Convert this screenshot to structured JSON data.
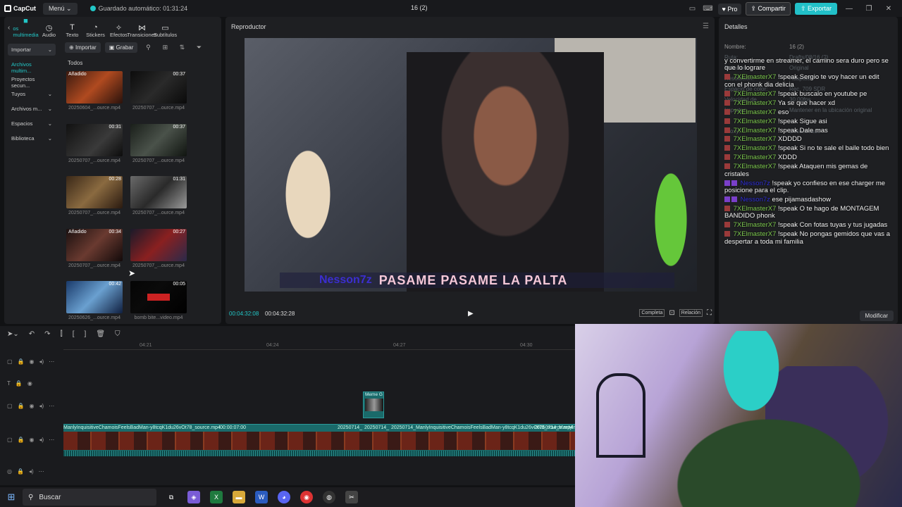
{
  "titlebar": {
    "logo": "CapCut",
    "menu": "Menú",
    "autosave": "Guardado automático: 01:31:24",
    "project_title": "16 (2)",
    "pro": "Pro",
    "share": "Compartir",
    "export": "Exportar"
  },
  "tabs": [
    {
      "icon": "■",
      "label": "os multimedia"
    },
    {
      "icon": "◷",
      "label": "Audio"
    },
    {
      "icon": "T",
      "label": "Texto"
    },
    {
      "icon": "◔",
      "label": "Stickers"
    },
    {
      "icon": "✧",
      "label": "Efectos"
    },
    {
      "icon": "⋈",
      "label": "Transiciones"
    },
    {
      "icon": "▭",
      "label": "Subtítulos"
    }
  ],
  "sidebar": [
    {
      "label": "Importar"
    },
    {
      "label": "Archivos multim..."
    },
    {
      "label": "Proyectos secun..."
    },
    {
      "label": "Tuyos"
    },
    {
      "label": "Archivos m..."
    },
    {
      "label": "Espacios"
    },
    {
      "label": "Biblioteca"
    }
  ],
  "media_toolbar": {
    "import": "Importar",
    "record": "Grabar"
  },
  "media_section": "Todos",
  "media_items": [
    {
      "name": "20250604_...ource.mp4",
      "duration": "",
      "added": "Añadido"
    },
    {
      "name": "20250707_...ource.mp4",
      "duration": "00:37",
      "added": ""
    },
    {
      "name": "20250707_...ource.mp4",
      "duration": "00:31",
      "added": ""
    },
    {
      "name": "20250707_...ource.mp4",
      "duration": "00:37",
      "added": ""
    },
    {
      "name": "20250707_...ource.mp4",
      "duration": "00:28",
      "added": ""
    },
    {
      "name": "20250707_...ource.mp4",
      "duration": "01:31",
      "added": ""
    },
    {
      "name": "20250707_...ource.mp4",
      "duration": "00:34",
      "added": "Añadido"
    },
    {
      "name": "20250707_...ource.mp4",
      "duration": "00:27",
      "added": ""
    },
    {
      "name": "20250626_...ource.mp4",
      "duration": "00:42",
      "added": ""
    },
    {
      "name": "bomb bite...video.mp4",
      "duration": "00:05",
      "added": ""
    }
  ],
  "player": {
    "title": "Reproductor",
    "caption_user": "Nesson7z",
    "caption_text": "PASAME PASAME LA PALTA",
    "time_current": "00:04:32:08",
    "time_total": "00:04:32:28",
    "full": "Completa",
    "ratio": "Relación"
  },
  "details": {
    "title": "Detalles",
    "rows": [
      {
        "k": "Nombre:",
        "v": "16 (2)"
      },
      {
        "k": "Ruta:",
        "v": "Drafts/08/16 (2)"
      },
      {
        "k": "Relación:",
        "v": "Original"
      },
      {
        "k": "Resolución:",
        "v": "Adaptado"
      },
      {
        "k": "Espacio de color:",
        "v": "Rec. 709 SDR"
      },
      {
        "k": "Velocidad de...",
        "v": "30.00fps"
      },
      {
        "k": "Importar:",
        "v": "Mantener en la ubicación original"
      },
      {
        "k": "",
        "v": ""
      },
      {
        "k": "Proxy:",
        "v": "Desactivado"
      }
    ],
    "modify": "Modificar"
  },
  "chat": [
    {
      "badge": "",
      "user": "",
      "text": "y convertirme en streamer, el camino sera duro pero se que lo lograre"
    },
    {
      "badge": "r",
      "user": "7XElmasterX7",
      "text": "!speak Sergio te voy hacer un edit con el phonk dia delicia"
    },
    {
      "badge": "r",
      "user": "7XElmasterX7",
      "text": "!speak buscalo en youtube pe"
    },
    {
      "badge": "r",
      "user": "7XElmasterX7",
      "text": "Ya se que hacer xd"
    },
    {
      "badge": "r",
      "user": "7XElmasterX7",
      "text": "eso"
    },
    {
      "badge": "r",
      "user": "7XElmasterX7",
      "text": "!speak Sigue asi"
    },
    {
      "badge": "r",
      "user": "7XElmasterX7",
      "text": "!speak Dale mas"
    },
    {
      "badge": "r",
      "user": "7XElmasterX7",
      "text": "XDDDD"
    },
    {
      "badge": "r",
      "user": "7XElmasterX7",
      "text": "!speak Si no te sale el baile todo bien"
    },
    {
      "badge": "r",
      "user": "7XElmasterX7",
      "text": "XDDD"
    },
    {
      "badge": "r",
      "user": "7XElmasterX7",
      "text": "!speak Ataquen mis gemas de cristales"
    },
    {
      "badge": "p",
      "user": "Nesson7z",
      "text": "!speak yo confieso en ese charger me posicione para el clip."
    },
    {
      "badge": "p",
      "user": "Nesson7z",
      "text": "ese pijamasdashow"
    },
    {
      "badge": "r",
      "user": "7XElmasterX7",
      "text": "!speak O te hago de MONTAGEM BANDIDO phonk"
    },
    {
      "badge": "r",
      "user": "7XElmasterX7",
      "text": "!speak Con fotas tuyas y tus jugadas"
    },
    {
      "badge": "r",
      "user": "7XElmasterX7",
      "text": "!speak No pongas gemidos que vas a despertar a toda mi familia"
    }
  ],
  "timeline": {
    "ruler": [
      "04:21",
      "04:24",
      "04:27",
      "04:30"
    ],
    "main_clip_label": "ManlyInquisitiveChamoisFeelsBadMan-y8tcqK1du26vOt78_source.mp4",
    "main_clip_time": "00:00:07:00",
    "clip2": "20250714_",
    "clip3": "20250714_",
    "clip4": "20250714_ManlyInquisitiveChamoisFeelsBadMan-y8tcqK1du26vOt78_source.mp4",
    "clip5": "20250714_ManlyInq",
    "meme_label": "Meme G"
  },
  "taskbar": {
    "search": "Buscar"
  }
}
